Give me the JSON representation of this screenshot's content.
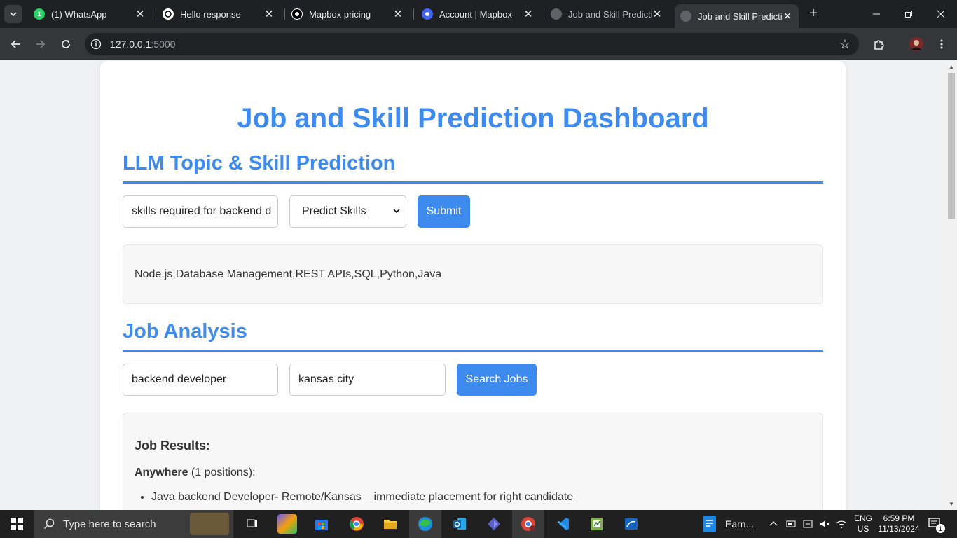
{
  "browser": {
    "tabs": [
      {
        "title": "(1) WhatsApp",
        "favicon": "whatsapp-icon",
        "badge": "1"
      },
      {
        "title": "Hello response",
        "favicon": "chatgpt-icon"
      },
      {
        "title": "Mapbox pricing",
        "favicon": "mapbox-icon"
      },
      {
        "title": "Account | Mapbox",
        "favicon": "mapbox-account-icon"
      },
      {
        "title": "Job and Skill Predictio",
        "favicon": "globe-icon"
      },
      {
        "title": "Job and Skill Predictio",
        "favicon": "globe-icon",
        "active": true
      }
    ],
    "url_host": "127.0.0.1",
    "url_port": ":5000"
  },
  "page": {
    "title": "Job and Skill Prediction Dashboard",
    "llm_section": {
      "heading": "LLM Topic & Skill Prediction",
      "query_value": "skills required for backend d",
      "mode_selected": "Predict Skills",
      "submit_label": "Submit",
      "result_text": "Node.js,Database Management,REST APIs,SQL,Python,Java"
    },
    "job_section": {
      "heading": "Job Analysis",
      "role_value": "backend developer",
      "location_value": "kansas city",
      "search_label": "Search Jobs",
      "results_heading": "Job Results:",
      "groups": [
        {
          "location": "Anywhere",
          "count_text": "(1 positions):",
          "jobs": [
            "Java backend Developer- Remote/Kansas _ immediate placement for right candidate"
          ]
        }
      ]
    }
  },
  "taskbar": {
    "search_placeholder": "Type here to search",
    "pinned_app_label": "Earn...",
    "lang_top": "ENG",
    "lang_bottom": "US",
    "time": "6:59 PM",
    "date": "11/13/2024",
    "notif_count": "1"
  },
  "colors": {
    "accent": "#3d8bef",
    "tab_strip": "#1f2024",
    "toolbar": "#35363a"
  }
}
